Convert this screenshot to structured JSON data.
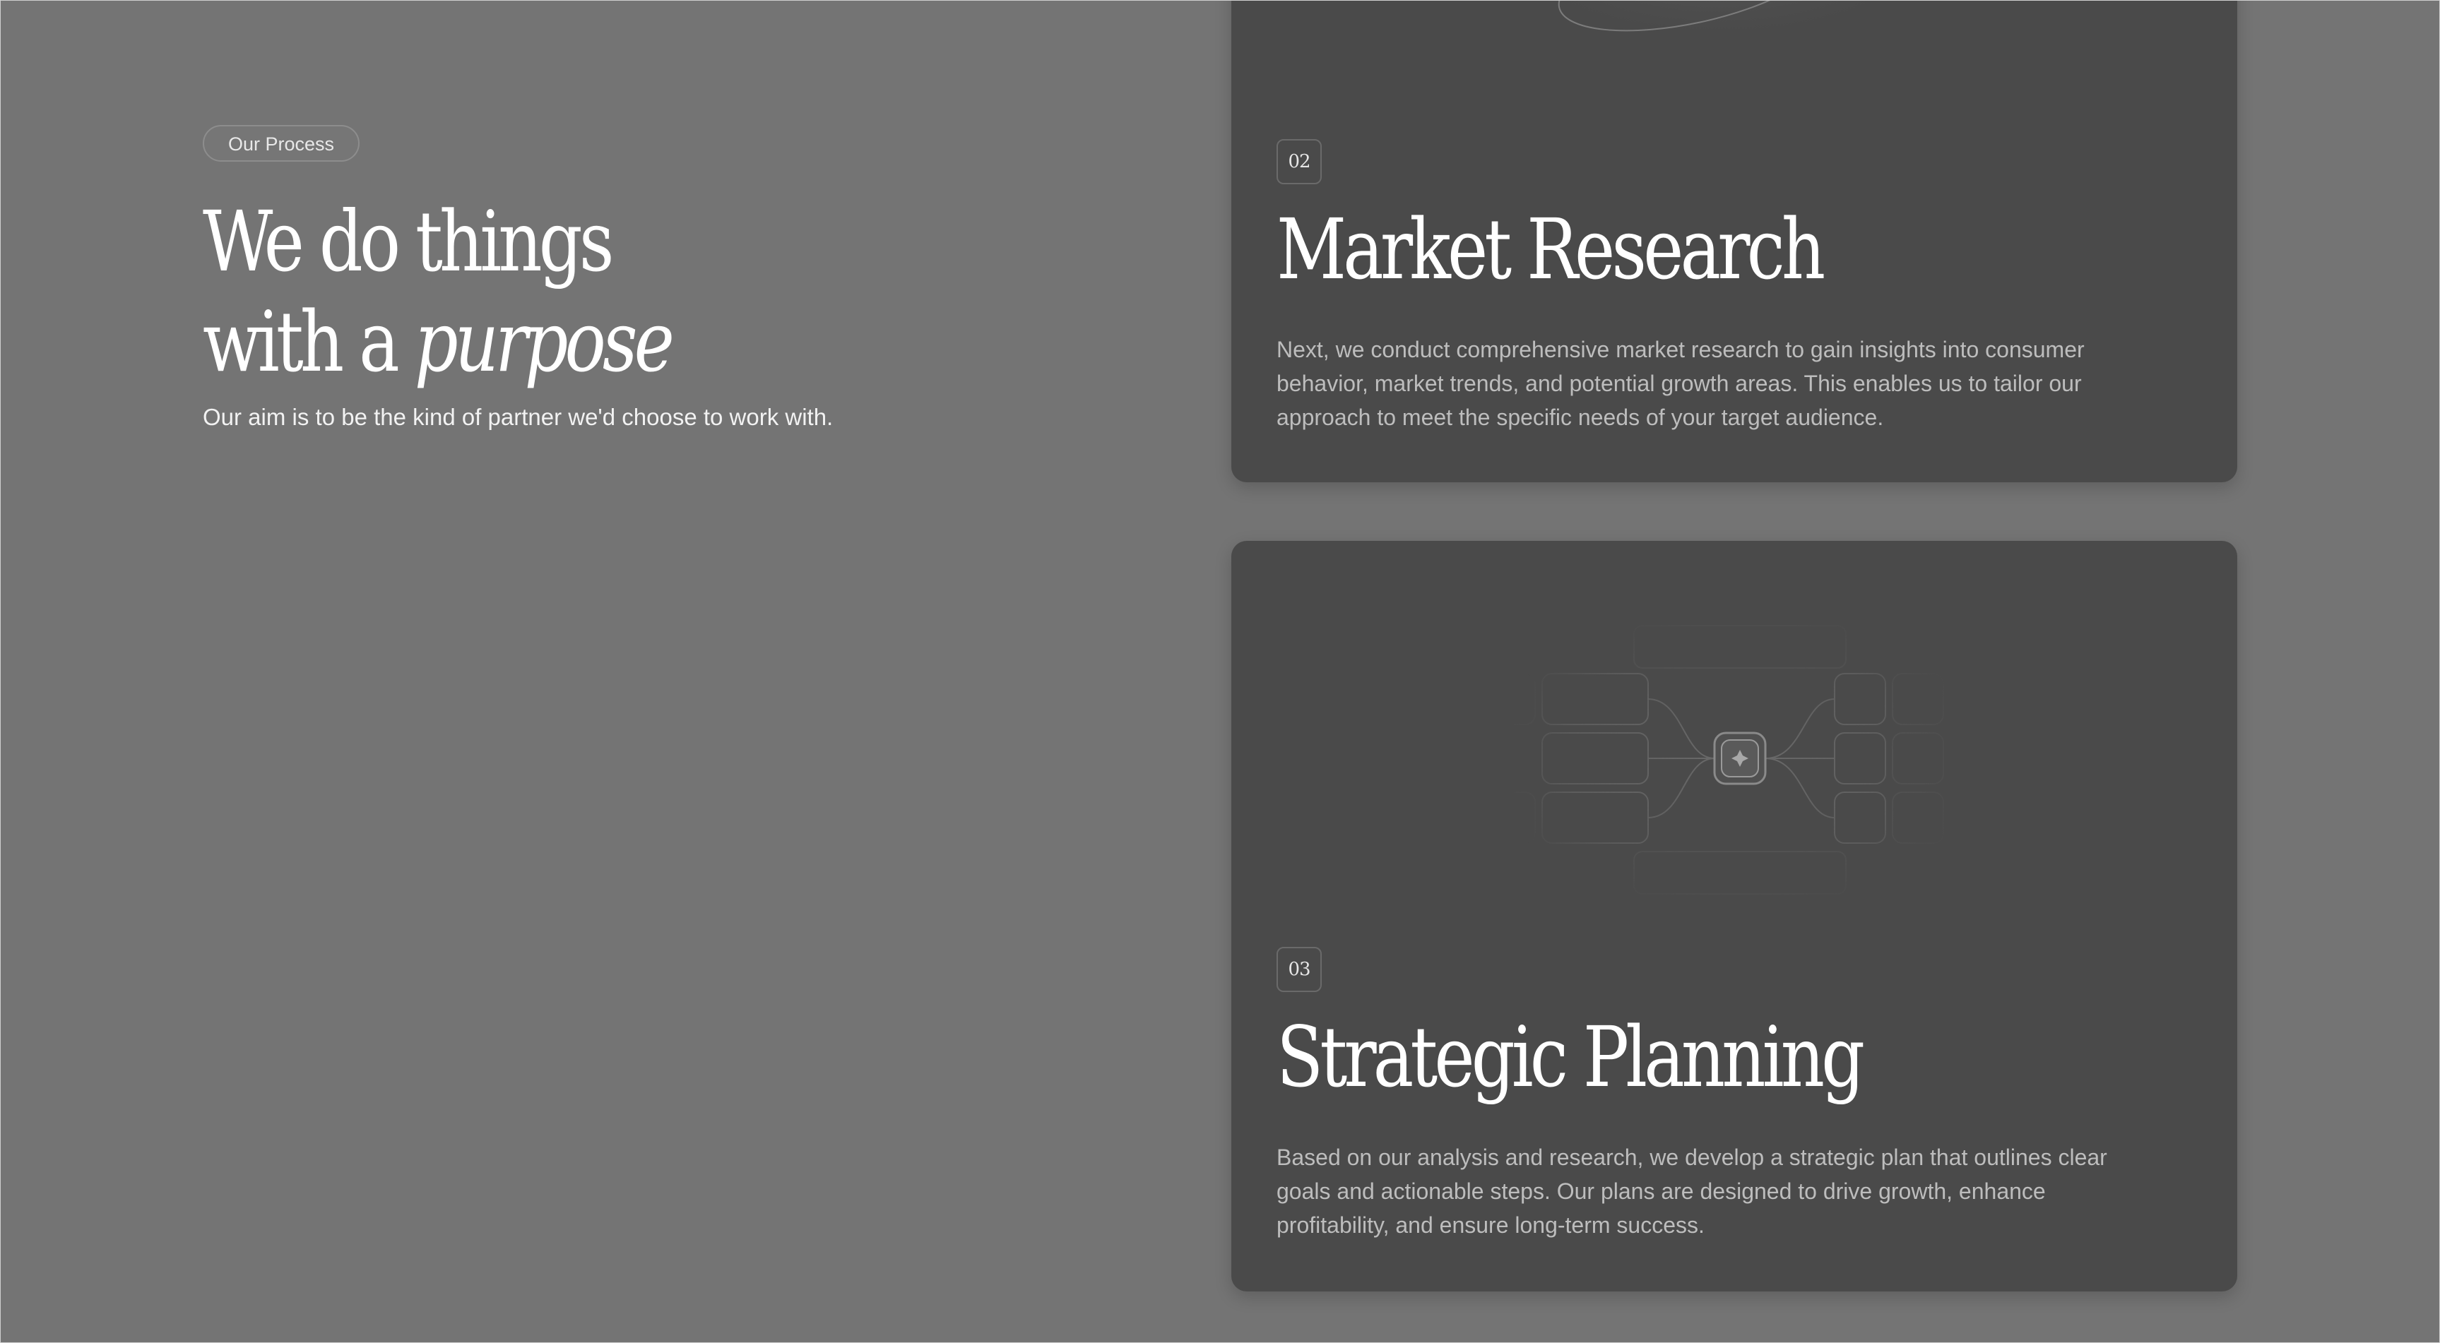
{
  "intro": {
    "badge": "Our Process",
    "headline_line1": "We do things",
    "headline_line2_prefix": "with a ",
    "headline_line2_emphasis": "purpose",
    "lead": "Our aim is to be the kind of partner we'd choose to work with."
  },
  "cards": [
    {
      "number": "02",
      "title": "Market Research",
      "description": "Next, we conduct comprehensive market research to gain insights into consumer behavior, market trends, and potential growth areas. This enables us to tailor our approach to meet the specific needs of your target audience.",
      "illustration_icon": "orbit-illustration-icon"
    },
    {
      "number": "03",
      "title": "Strategic Planning",
      "description": "Based on our analysis and research, we develop a strategic plan that outlines clear goals and actionable steps. Our plans are designed to drive growth, enhance profitability, and ensure long-term success.",
      "illustration_icon": "mindmap-illustration-icon",
      "center_node_icon": "sparkle-icon"
    }
  ],
  "colors": {
    "page_background": "#747474",
    "card_background": "#4a4a4a",
    "title_text": "#ffffff",
    "body_text": "#bdbdbd"
  }
}
